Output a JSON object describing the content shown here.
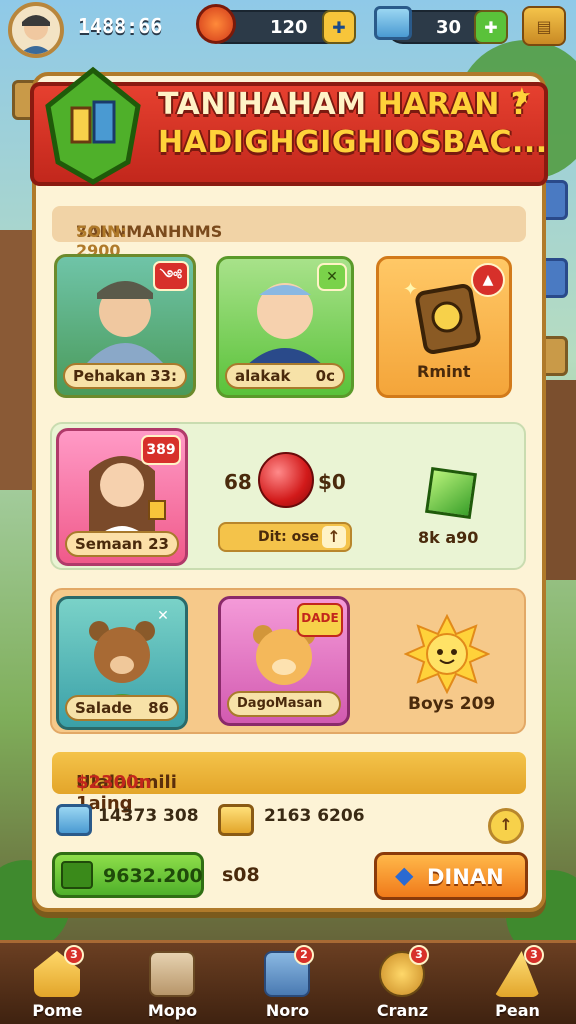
{
  "topbar": {
    "player_id": "1488:66",
    "coins_value": "120",
    "gems_value": "30"
  },
  "banner": {
    "title_line1_a": "TANIHAHAM ",
    "title_line1_b": "HARAN",
    "title_line1_c": " ?",
    "title_line2": "HADIGHGIGHIOSBAC..."
  },
  "info_strip": {
    "label": "7ANNMANHNMS",
    "value": "SOIN: 2900"
  },
  "row1": [
    {
      "label": "Pehakan",
      "value": "33:",
      "badge": "༺"
    },
    {
      "label": "alakak",
      "value": "0c"
    },
    {
      "label": "Rmint"
    }
  ],
  "row2": {
    "card_label": "Semaan",
    "card_value": "23",
    "card_badge": "389",
    "ball_left": "68",
    "ball_right": "$0",
    "slider_label": "Dit: ose",
    "gem_label": "8k a90"
  },
  "row3": [
    {
      "label": "Salade",
      "value": "86"
    },
    {
      "label": "DagoMasan",
      "badge": "DADE"
    },
    {
      "label": "Boys 209"
    }
  ],
  "summary": {
    "label": "Ulalalanili 1aing",
    "value": "$2300n"
  },
  "stats": {
    "left_value": "14373 308",
    "right_value": "2163 6206"
  },
  "actions": {
    "green_label": "9632.200",
    "mid_value": "s08",
    "orange_label": "DINAN"
  },
  "bottom_nav": [
    {
      "label": "Pome",
      "badge": "3"
    },
    {
      "label": "Mopo",
      "badge": ""
    },
    {
      "label": "Noro",
      "badge": "2"
    },
    {
      "label": "Cranz",
      "badge": "3"
    },
    {
      "label": "Pean",
      "badge": "3"
    }
  ]
}
